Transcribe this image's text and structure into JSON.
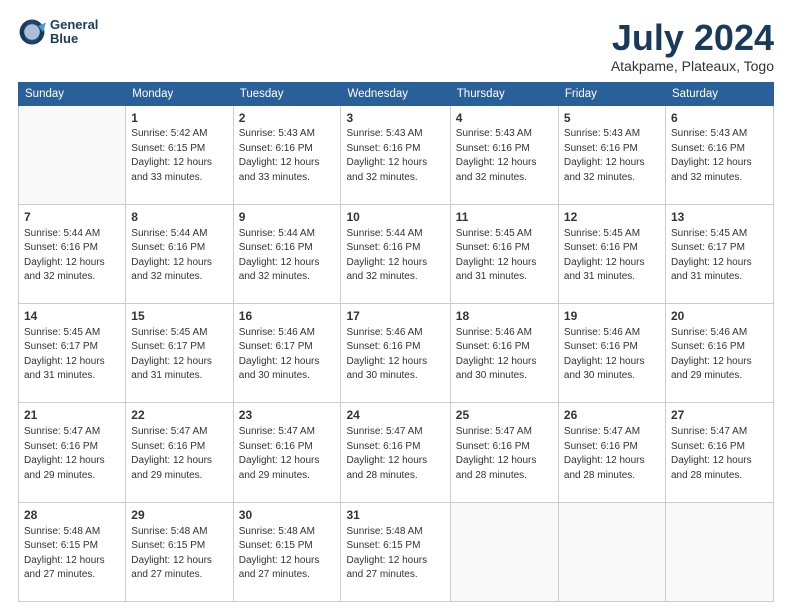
{
  "header": {
    "logo_line1": "General",
    "logo_line2": "Blue",
    "month": "July 2024",
    "location": "Atakpame, Plateaux, Togo"
  },
  "days_of_week": [
    "Sunday",
    "Monday",
    "Tuesday",
    "Wednesday",
    "Thursday",
    "Friday",
    "Saturday"
  ],
  "weeks": [
    [
      {
        "day": "",
        "sunrise": "",
        "sunset": "",
        "daylight": ""
      },
      {
        "day": "1",
        "sunrise": "Sunrise: 5:42 AM",
        "sunset": "Sunset: 6:15 PM",
        "daylight": "Daylight: 12 hours and 33 minutes."
      },
      {
        "day": "2",
        "sunrise": "Sunrise: 5:43 AM",
        "sunset": "Sunset: 6:16 PM",
        "daylight": "Daylight: 12 hours and 33 minutes."
      },
      {
        "day": "3",
        "sunrise": "Sunrise: 5:43 AM",
        "sunset": "Sunset: 6:16 PM",
        "daylight": "Daylight: 12 hours and 32 minutes."
      },
      {
        "day": "4",
        "sunrise": "Sunrise: 5:43 AM",
        "sunset": "Sunset: 6:16 PM",
        "daylight": "Daylight: 12 hours and 32 minutes."
      },
      {
        "day": "5",
        "sunrise": "Sunrise: 5:43 AM",
        "sunset": "Sunset: 6:16 PM",
        "daylight": "Daylight: 12 hours and 32 minutes."
      },
      {
        "day": "6",
        "sunrise": "Sunrise: 5:43 AM",
        "sunset": "Sunset: 6:16 PM",
        "daylight": "Daylight: 12 hours and 32 minutes."
      }
    ],
    [
      {
        "day": "7",
        "sunrise": "Sunrise: 5:44 AM",
        "sunset": "Sunset: 6:16 PM",
        "daylight": "Daylight: 12 hours and 32 minutes."
      },
      {
        "day": "8",
        "sunrise": "Sunrise: 5:44 AM",
        "sunset": "Sunset: 6:16 PM",
        "daylight": "Daylight: 12 hours and 32 minutes."
      },
      {
        "day": "9",
        "sunrise": "Sunrise: 5:44 AM",
        "sunset": "Sunset: 6:16 PM",
        "daylight": "Daylight: 12 hours and 32 minutes."
      },
      {
        "day": "10",
        "sunrise": "Sunrise: 5:44 AM",
        "sunset": "Sunset: 6:16 PM",
        "daylight": "Daylight: 12 hours and 32 minutes."
      },
      {
        "day": "11",
        "sunrise": "Sunrise: 5:45 AM",
        "sunset": "Sunset: 6:16 PM",
        "daylight": "Daylight: 12 hours and 31 minutes."
      },
      {
        "day": "12",
        "sunrise": "Sunrise: 5:45 AM",
        "sunset": "Sunset: 6:16 PM",
        "daylight": "Daylight: 12 hours and 31 minutes."
      },
      {
        "day": "13",
        "sunrise": "Sunrise: 5:45 AM",
        "sunset": "Sunset: 6:17 PM",
        "daylight": "Daylight: 12 hours and 31 minutes."
      }
    ],
    [
      {
        "day": "14",
        "sunrise": "Sunrise: 5:45 AM",
        "sunset": "Sunset: 6:17 PM",
        "daylight": "Daylight: 12 hours and 31 minutes."
      },
      {
        "day": "15",
        "sunrise": "Sunrise: 5:45 AM",
        "sunset": "Sunset: 6:17 PM",
        "daylight": "Daylight: 12 hours and 31 minutes."
      },
      {
        "day": "16",
        "sunrise": "Sunrise: 5:46 AM",
        "sunset": "Sunset: 6:17 PM",
        "daylight": "Daylight: 12 hours and 30 minutes."
      },
      {
        "day": "17",
        "sunrise": "Sunrise: 5:46 AM",
        "sunset": "Sunset: 6:16 PM",
        "daylight": "Daylight: 12 hours and 30 minutes."
      },
      {
        "day": "18",
        "sunrise": "Sunrise: 5:46 AM",
        "sunset": "Sunset: 6:16 PM",
        "daylight": "Daylight: 12 hours and 30 minutes."
      },
      {
        "day": "19",
        "sunrise": "Sunrise: 5:46 AM",
        "sunset": "Sunset: 6:16 PM",
        "daylight": "Daylight: 12 hours and 30 minutes."
      },
      {
        "day": "20",
        "sunrise": "Sunrise: 5:46 AM",
        "sunset": "Sunset: 6:16 PM",
        "daylight": "Daylight: 12 hours and 29 minutes."
      }
    ],
    [
      {
        "day": "21",
        "sunrise": "Sunrise: 5:47 AM",
        "sunset": "Sunset: 6:16 PM",
        "daylight": "Daylight: 12 hours and 29 minutes."
      },
      {
        "day": "22",
        "sunrise": "Sunrise: 5:47 AM",
        "sunset": "Sunset: 6:16 PM",
        "daylight": "Daylight: 12 hours and 29 minutes."
      },
      {
        "day": "23",
        "sunrise": "Sunrise: 5:47 AM",
        "sunset": "Sunset: 6:16 PM",
        "daylight": "Daylight: 12 hours and 29 minutes."
      },
      {
        "day": "24",
        "sunrise": "Sunrise: 5:47 AM",
        "sunset": "Sunset: 6:16 PM",
        "daylight": "Daylight: 12 hours and 28 minutes."
      },
      {
        "day": "25",
        "sunrise": "Sunrise: 5:47 AM",
        "sunset": "Sunset: 6:16 PM",
        "daylight": "Daylight: 12 hours and 28 minutes."
      },
      {
        "day": "26",
        "sunrise": "Sunrise: 5:47 AM",
        "sunset": "Sunset: 6:16 PM",
        "daylight": "Daylight: 12 hours and 28 minutes."
      },
      {
        "day": "27",
        "sunrise": "Sunrise: 5:47 AM",
        "sunset": "Sunset: 6:16 PM",
        "daylight": "Daylight: 12 hours and 28 minutes."
      }
    ],
    [
      {
        "day": "28",
        "sunrise": "Sunrise: 5:48 AM",
        "sunset": "Sunset: 6:15 PM",
        "daylight": "Daylight: 12 hours and 27 minutes."
      },
      {
        "day": "29",
        "sunrise": "Sunrise: 5:48 AM",
        "sunset": "Sunset: 6:15 PM",
        "daylight": "Daylight: 12 hours and 27 minutes."
      },
      {
        "day": "30",
        "sunrise": "Sunrise: 5:48 AM",
        "sunset": "Sunset: 6:15 PM",
        "daylight": "Daylight: 12 hours and 27 minutes."
      },
      {
        "day": "31",
        "sunrise": "Sunrise: 5:48 AM",
        "sunset": "Sunset: 6:15 PM",
        "daylight": "Daylight: 12 hours and 27 minutes."
      },
      {
        "day": "",
        "sunrise": "",
        "sunset": "",
        "daylight": ""
      },
      {
        "day": "",
        "sunrise": "",
        "sunset": "",
        "daylight": ""
      },
      {
        "day": "",
        "sunrise": "",
        "sunset": "",
        "daylight": ""
      }
    ]
  ]
}
